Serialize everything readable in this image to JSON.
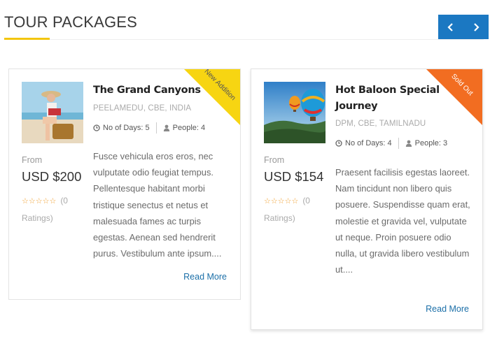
{
  "section": {
    "title": "TOUR PACKAGES"
  },
  "nav": {
    "prev_icon": "chevron-left-icon",
    "next_icon": "chevron-right-icon",
    "color": "#1b78c2"
  },
  "packages": [
    {
      "title": "The Grand Canyons",
      "location": "PEELAMEDU, CBE, INDIA",
      "ribbon": "New Addition",
      "ribbon_color": "#f7d512",
      "days": "No of Days: 5",
      "people": "People: 4",
      "from_label": "From",
      "price": "USD $200",
      "stars": "☆☆☆☆☆",
      "ratings": "(0 Ratings)",
      "description": "Fusce vehicula eros eros, nec vulputate odio feugiat tempus. Pellentesque habitant morbi tristique senectus et netus et malesuada fames ac turpis egestas. Aenean sed hendrerit purus. Vestibulum ante ipsum....",
      "read_more": "Read More"
    },
    {
      "title": "Hot Baloon Special Journey",
      "location": "DPM, CBE, TAMILNADU",
      "ribbon": "Sold Out",
      "ribbon_color": "#f26d21",
      "days": "No of Days: 4",
      "people": "People: 3",
      "from_label": "From",
      "price": "USD $154",
      "stars": "☆☆☆☆☆",
      "ratings": "(0 Ratings)",
      "description": "Praesent facilisis egestas laoreet. Nam tincidunt non libero quis posuere. Suspendisse quam erat, molestie et gravida vel, vulputate ut neque. Proin posuere odio nulla, ut gravida libero vestibulum ut....",
      "read_more": "Read More"
    }
  ]
}
